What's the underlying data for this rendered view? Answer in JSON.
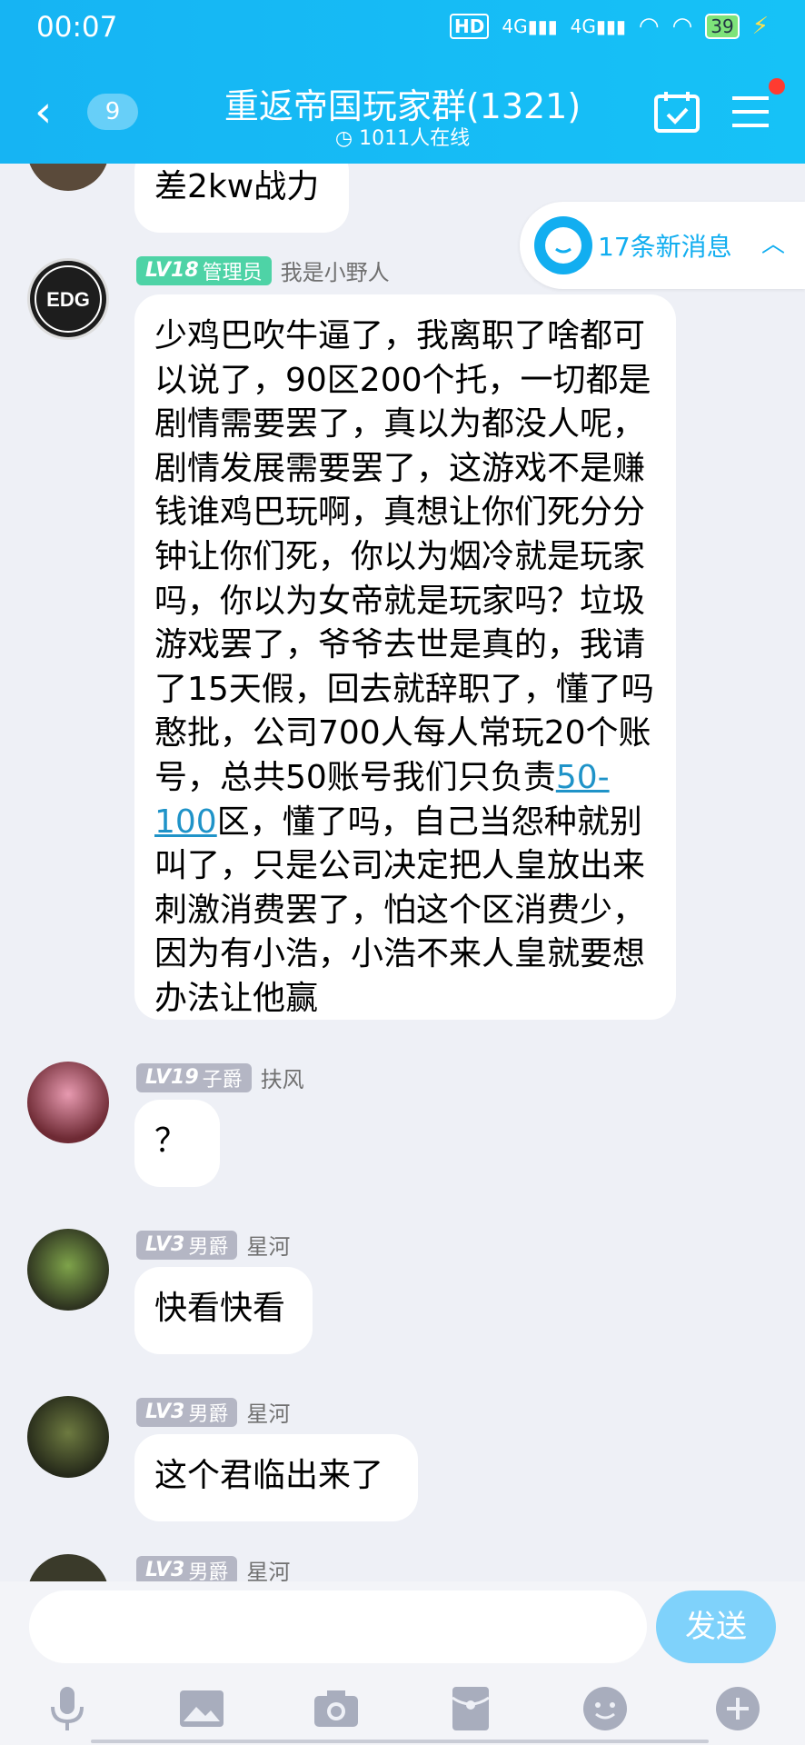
{
  "status": {
    "time": "00:07",
    "hd": "HD",
    "net1": "4G",
    "net2": "4G",
    "battery": "39"
  },
  "header": {
    "back_count": "9",
    "title": "重返帝国玩家群(1321)",
    "online": "1011人在线"
  },
  "new_messages": "17条新消息",
  "top_partial": "差2kw战力",
  "messages": [
    {
      "level": "LV18",
      "title": "管理员",
      "name": "我是小野人",
      "text_before": "少鸡巴吹牛逼了，我离职了啥都可以说了，90区200个托，一切都是剧情需要罢了，真以为都没人呢，剧情发展需要罢了，这游戏不是赚钱谁鸡巴玩啊，真想让你们死分分钟让你们死，你以为烟冷就是玩家吗，你以为女帝就是玩家吗？垃圾游戏罢了，爷爷去世是真的，我请了15天假，回去就辞职了，懂了吗憨批，公司700人每人常玩20个账号，总共50账号我们只负责",
      "link": "50-100",
      "text_after": "区，懂了吗，自己当怨种就别叫了，只是公司决定把人皇放出来刺激消费罢了，怕这个区消费少，因为有小浩，小浩不来人皇就要想办法让他赢",
      "avatar_label": "EDG"
    },
    {
      "level": "LV19",
      "title": "子爵",
      "name": "扶风",
      "text": "？"
    },
    {
      "level": "LV3",
      "title": "男爵",
      "name": "星河",
      "text": "快看快看"
    },
    {
      "level": "LV3",
      "title": "男爵",
      "name": "星河",
      "text": "这个君临出来了"
    },
    {
      "level": "LV3",
      "title": "男爵",
      "name": "星河"
    }
  ],
  "input": {
    "placeholder": "",
    "send_label": "发送"
  },
  "tools": [
    "microphone-icon",
    "image-icon",
    "camera-icon",
    "red-packet-icon",
    "emoji-icon",
    "plus-icon"
  ],
  "colors": {
    "header": "#16b4f3",
    "accent": "#12aef0",
    "level_green": "#4ed3a6",
    "level_gray": "#b4b6c4",
    "send": "#7fd2fb"
  }
}
